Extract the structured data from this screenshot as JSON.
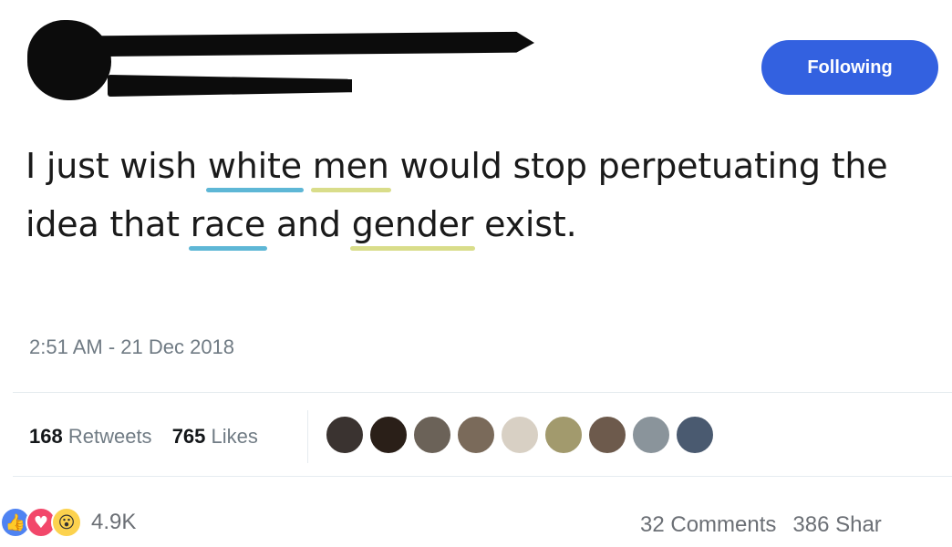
{
  "header": {
    "follow_label": "Following"
  },
  "tweet": {
    "text_parts": [
      "I just wish ",
      "white",
      " ",
      "men",
      " would stop perpetuating the idea that ",
      "race",
      " and ",
      "gender",
      " exist."
    ],
    "underline_colors": {
      "blue": "#5eb7d6",
      "yellow": "#d9dd8a"
    },
    "timestamp": "2:51 AM - 21 Dec 2018"
  },
  "stats": {
    "retweets_count": "168",
    "retweets_label": "Retweets",
    "likes_count": "765",
    "likes_label": "Likes",
    "liker_avatars": [
      "#3a3330",
      "#2a1f18",
      "#6b6258",
      "#7a6a5a",
      "#d8d0c4",
      "#a29a6d",
      "#6d5a4c",
      "#8a949b",
      "#4a5a70"
    ]
  },
  "facebook_footer": {
    "reaction_icons": [
      "like-icon",
      "love-icon",
      "wow-icon"
    ],
    "reaction_count": "4.9K",
    "comments": "32 Comments",
    "shares": "386 Shar"
  }
}
